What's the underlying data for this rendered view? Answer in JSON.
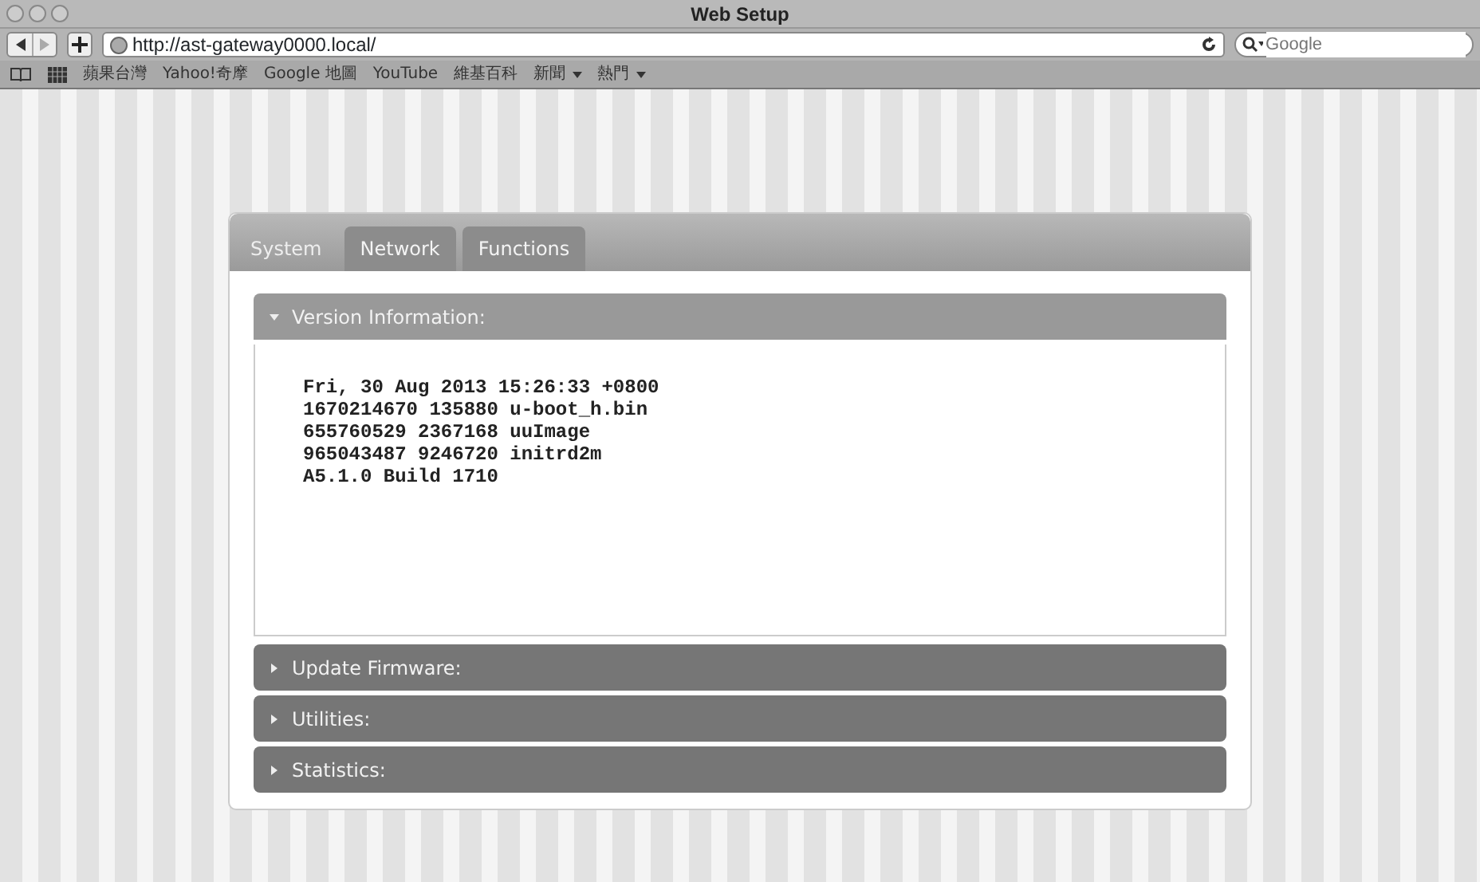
{
  "window": {
    "title": "Web Setup"
  },
  "toolbar": {
    "address": "http://ast-gateway0000.local/",
    "search_placeholder": "Google"
  },
  "bookmarks": [
    {
      "label": "蘋果台灣",
      "menu": false
    },
    {
      "label": "Yahoo!奇摩",
      "menu": false
    },
    {
      "label": "Google 地圖",
      "menu": false
    },
    {
      "label": "YouTube",
      "menu": false
    },
    {
      "label": "維基百科",
      "menu": false
    },
    {
      "label": "新聞",
      "menu": true
    },
    {
      "label": "熱門",
      "menu": true
    }
  ],
  "tabs": [
    {
      "label": "System",
      "selected": true
    },
    {
      "label": "Network",
      "selected": false
    },
    {
      "label": "Functions",
      "selected": false
    }
  ],
  "sections": [
    {
      "title": "Version Information:",
      "expanded": true,
      "lines": [
        "Fri, 30 Aug 2013 15:26:33 +0800",
        "1670214670 135880 u-boot_h.bin",
        "655760529 2367168 uuImage",
        "965043487 9246720 initrd2m",
        "A5.1.0 Build 1710"
      ]
    },
    {
      "title": "Update Firmware:",
      "expanded": false
    },
    {
      "title": "Utilities:",
      "expanded": false
    },
    {
      "title": "Statistics:",
      "expanded": false
    }
  ]
}
